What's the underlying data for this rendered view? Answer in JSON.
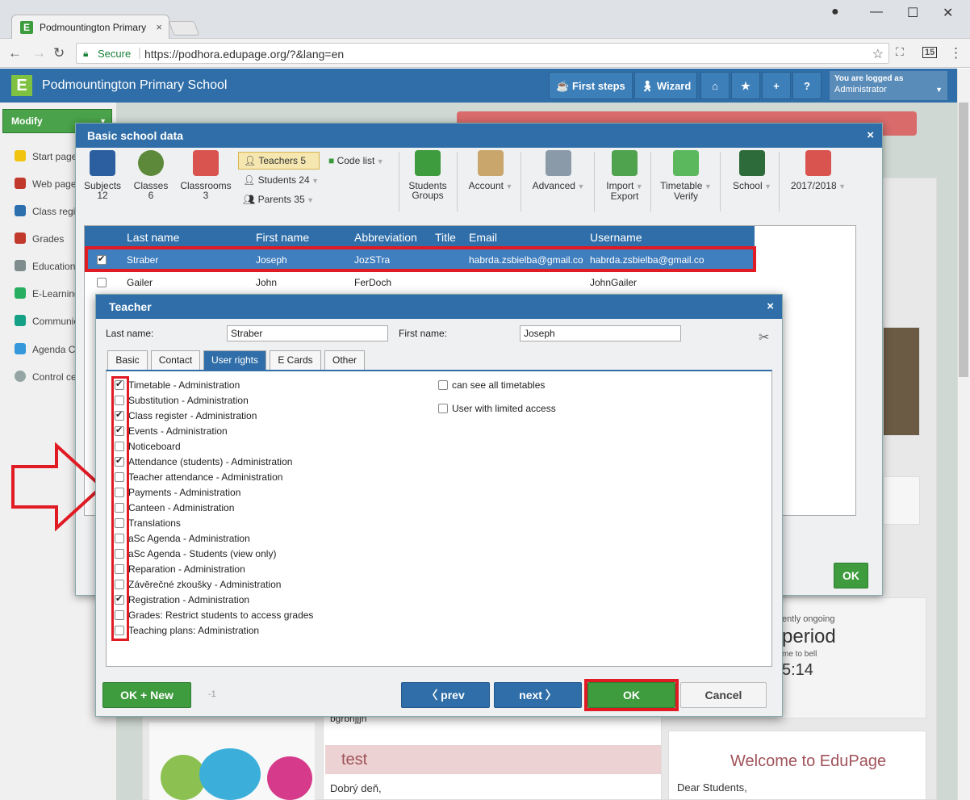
{
  "browser": {
    "tab_title": "Podmountington Primary",
    "tab_close": "×",
    "secure_label": "Secure",
    "url": "https://podhora.edupage.org/?&lang=en",
    "ext_badge": "15"
  },
  "app": {
    "logo": "E",
    "school_name": "Podmountington Primary School",
    "first_steps": "First steps",
    "wizard": "Wizard",
    "logged_label": "You are logged as",
    "logged_user": "Administrator"
  },
  "left_menu": {
    "modify": "Modify",
    "items": [
      "Start page",
      "Web pages",
      "Class register",
      "Grades",
      "Education",
      "E-Learning",
      "Communication",
      "Agenda C",
      "Control center"
    ]
  },
  "school_dialog": {
    "title": "Basic school data",
    "close": "×",
    "toolbar": {
      "subjects": "Subjects",
      "subjects_count": "12",
      "classes": "Classes",
      "classes_count": "6",
      "classrooms": "Classrooms",
      "classrooms_count": "3",
      "teachers": "Teachers 5",
      "students": "Students 24",
      "parents": "Parents 35",
      "code_list": "Code list",
      "students_groups_1": "Students",
      "students_groups_2": "Groups",
      "account": "Account",
      "advanced": "Advanced",
      "import": "Import",
      "export": "Export",
      "timetable": "Timetable",
      "verify": "Verify",
      "school": "School",
      "year": "2017/2018"
    },
    "columns": [
      "Last name",
      "First name",
      "Abbreviation",
      "Title",
      "Email",
      "Username"
    ],
    "rows": [
      {
        "last": "Straber",
        "first": "Joseph",
        "abbr": "JozSTra",
        "title": "",
        "email": "habrda.zsbielba@gmail.co",
        "user": "habrda.zsbielba@gmail.co",
        "checked": true
      },
      {
        "last": "Gailer",
        "first": "John",
        "abbr": "FerDoch",
        "title": "",
        "email": "",
        "user": "JohnGailer",
        "checked": false
      }
    ],
    "ok": "OK"
  },
  "teacher_dialog": {
    "title": "Teacher",
    "close": "×",
    "last_name_label": "Last name:",
    "last_name_value": "Straber",
    "first_name_label": "First name:",
    "first_name_value": "Joseph",
    "tabs": [
      "Basic",
      "Contact",
      "User rights",
      "E Cards",
      "Other"
    ],
    "active_tab": "User rights",
    "rights": [
      {
        "label": "Timetable - Administration",
        "checked": true
      },
      {
        "label": "Substitution - Administration",
        "checked": false
      },
      {
        "label": "Class register - Administration",
        "checked": true
      },
      {
        "label": "Events - Administration",
        "checked": true
      },
      {
        "label": "Noticeboard",
        "checked": false
      },
      {
        "label": "Attendance (students) - Administration",
        "checked": true
      },
      {
        "label": "Teacher attendance - Administration",
        "checked": false
      },
      {
        "label": "Payments - Administration",
        "checked": false
      },
      {
        "label": "Canteen - Administration",
        "checked": false
      },
      {
        "label": "Translations",
        "checked": false
      },
      {
        "label": "aSc Agenda - Administration",
        "checked": false
      },
      {
        "label": "aSc Agenda - Students (view only)",
        "checked": false
      },
      {
        "label": "Reparation - Administration",
        "checked": false
      },
      {
        "label": "Závěrečné zkoušky - Administration",
        "checked": false
      },
      {
        "label": "Registration - Administration",
        "checked": true
      },
      {
        "label": "Grades: Restrict students to access grades",
        "checked": false
      },
      {
        "label": "Teaching plans: Administration",
        "checked": false
      }
    ],
    "extra": [
      {
        "label": "can see all timetables",
        "checked": false
      },
      {
        "label": "User with limited access",
        "checked": false
      }
    ],
    "ok_new": "OK + New",
    "counter": "-1",
    "prev": "prev",
    "next": "next",
    "ok": "OK",
    "cancel": "Cancel"
  },
  "background": {
    "ongoing": "ently ongoing",
    "period": "period",
    "time_to_bell": "me to bell",
    "time": "5:14",
    "text1": "bgrbnjjjn",
    "test_title": "test",
    "test_text": "Dobrý deň,",
    "welcome_title": "Welcome to EduPage",
    "welcome_text": "Dear Students,"
  }
}
